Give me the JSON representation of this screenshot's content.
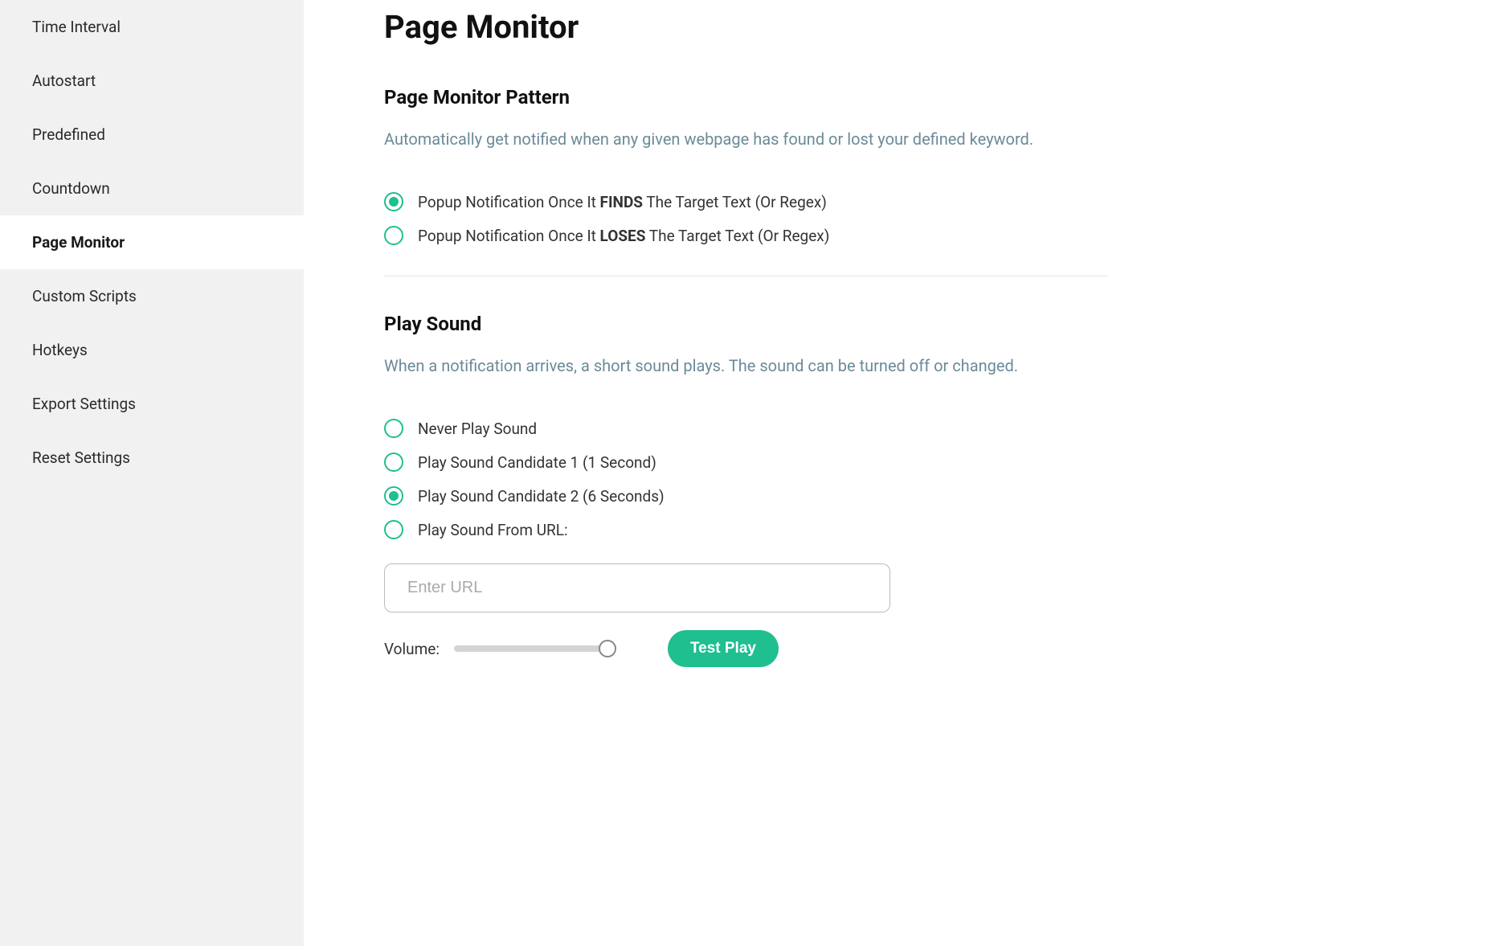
{
  "sidebar": {
    "items": [
      {
        "label": "Time Interval",
        "active": false
      },
      {
        "label": "Autostart",
        "active": false
      },
      {
        "label": "Predefined",
        "active": false
      },
      {
        "label": "Countdown",
        "active": false
      },
      {
        "label": "Page Monitor",
        "active": true
      },
      {
        "label": "Custom Scripts",
        "active": false
      },
      {
        "label": "Hotkeys",
        "active": false
      },
      {
        "label": "Export Settings",
        "active": false
      },
      {
        "label": "Reset Settings",
        "active": false
      }
    ]
  },
  "page": {
    "title": "Page Monitor"
  },
  "pattern": {
    "title": "Page Monitor Pattern",
    "description": "Automatically get notified when any given webpage has found or lost your defined keyword.",
    "options": [
      {
        "prefix": "Popup Notification Once It ",
        "bold": "FINDS",
        "suffix": " The Target Text (Or Regex)",
        "checked": true
      },
      {
        "prefix": "Popup Notification Once It ",
        "bold": "LOSES",
        "suffix": " The Target Text (Or Regex)",
        "checked": false
      }
    ]
  },
  "sound": {
    "title": "Play Sound",
    "description": "When a notification arrives, a short sound plays. The sound can be turned off or changed.",
    "options": [
      {
        "label": "Never Play Sound",
        "checked": false
      },
      {
        "label": "Play Sound Candidate 1 (1 Second)",
        "checked": false
      },
      {
        "label": "Play Sound Candidate 2 (6 Seconds)",
        "checked": true
      },
      {
        "label": "Play Sound From URL:",
        "checked": false
      }
    ],
    "url_placeholder": "Enter URL",
    "url_value": "",
    "volume_label": "Volume:",
    "volume_value": 100,
    "test_play_label": "Test Play"
  }
}
